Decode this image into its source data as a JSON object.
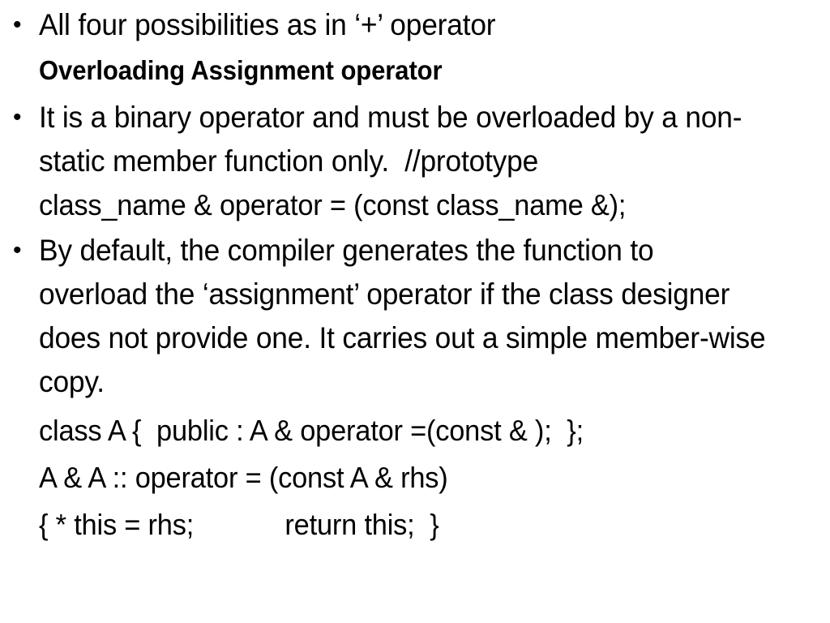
{
  "slide": {
    "background_color": "#ffffff",
    "text_color": "#000000",
    "bullet_glyph": "•",
    "blocks": [
      {
        "kind": "bullet",
        "text": "All four possibilities as in ‘+’ operator"
      },
      {
        "kind": "heading",
        "text": "Overloading Assignment operator"
      },
      {
        "kind": "bullet",
        "text": "It is a binary operator and must be overloaded by a non-static member function only.  //prototype"
      },
      {
        "kind": "code",
        "text": "class_name & operator = (const class_name &);"
      },
      {
        "kind": "bullet",
        "text": "By default, the compiler generates the function to overload the ‘assignment’ operator if the class designer does not provide one. It carries out a simple member-wise copy."
      },
      {
        "kind": "code",
        "text": "class A {  public : A & operator =(const & );  };"
      },
      {
        "kind": "code",
        "text": "A & A :: operator = (const A & rhs)"
      },
      {
        "kind": "code",
        "text": "{ * this = rhs;            return this;  }"
      }
    ]
  }
}
